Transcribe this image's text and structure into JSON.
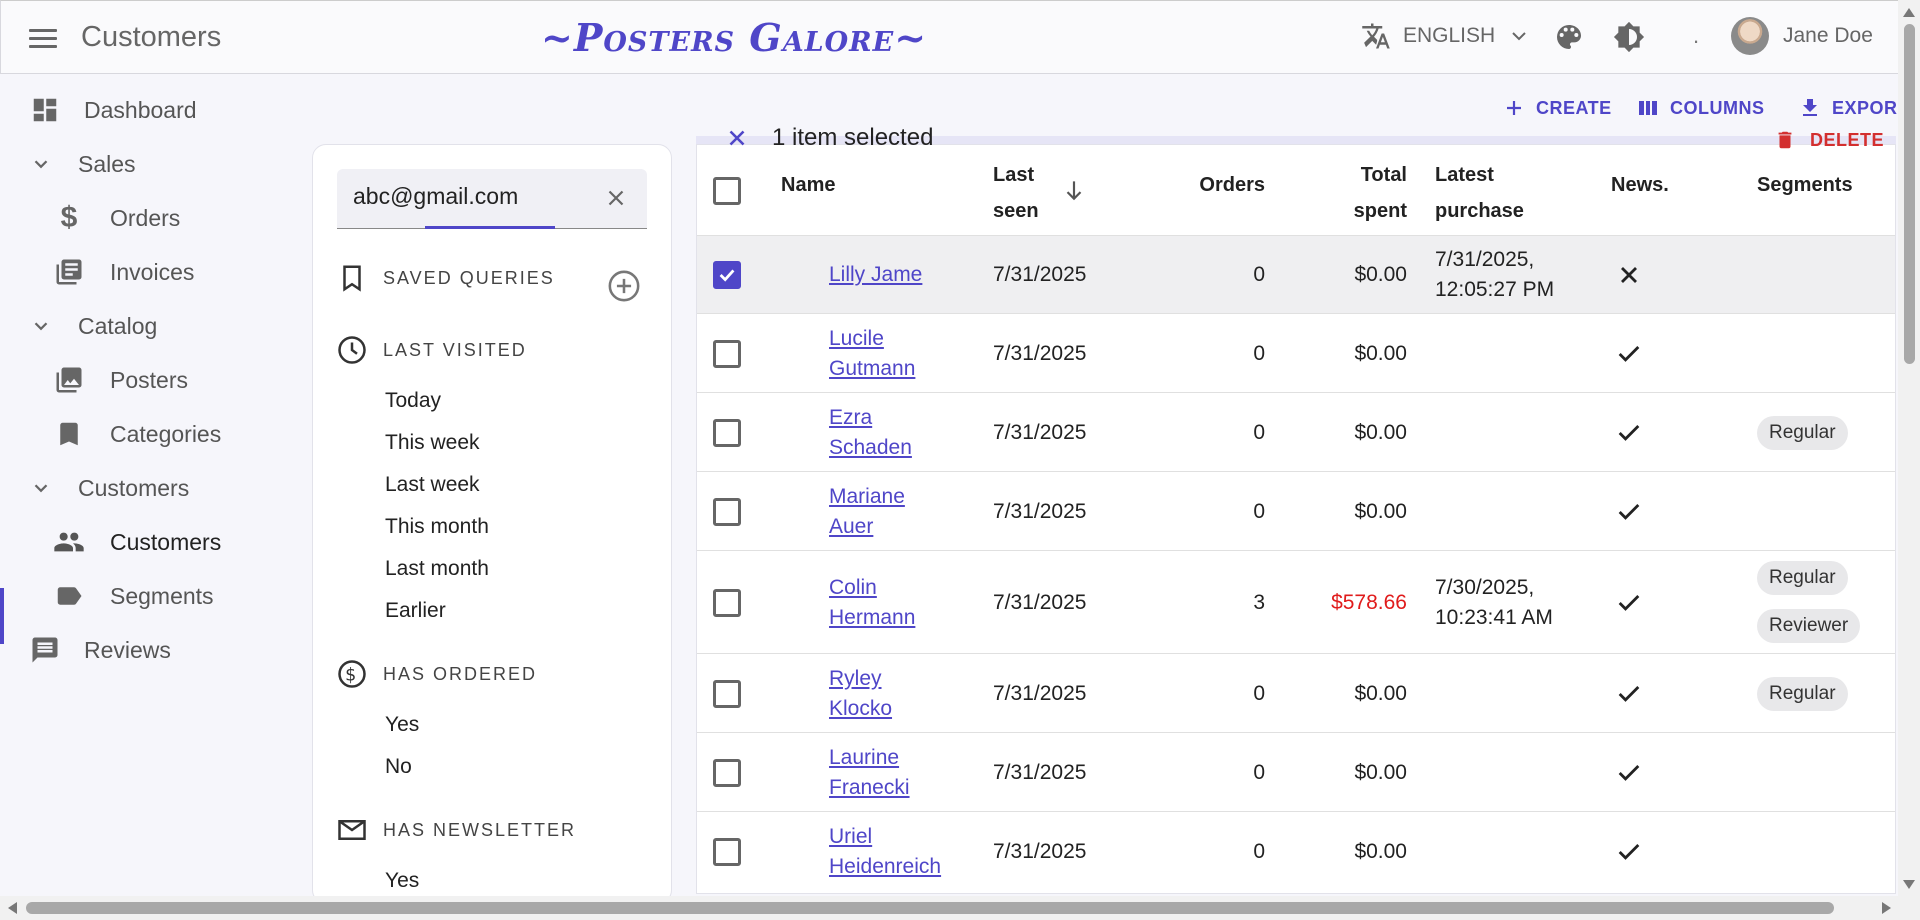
{
  "app": {
    "title": "Customers",
    "brand": "~Posters Galore~"
  },
  "header": {
    "language": "ENGLISH",
    "dot": ".",
    "user_name": "Jane Doe"
  },
  "sidebar": {
    "dashboard": "Dashboard",
    "sales": "Sales",
    "orders": "Orders",
    "invoices": "Invoices",
    "catalog": "Catalog",
    "posters": "Posters",
    "categories": "Categories",
    "customers_group": "Customers",
    "customers": "Customers",
    "segments": "Segments",
    "reviews": "Reviews"
  },
  "filters": {
    "search_value": "abc@gmail.com",
    "saved_queries": "SAVED QUERIES",
    "last_visited": "LAST VISITED",
    "last_visited_options": [
      "Today",
      "This week",
      "Last week",
      "This month",
      "Last month",
      "Earlier"
    ],
    "has_ordered": "HAS ORDERED",
    "has_ordered_options": [
      "Yes",
      "No"
    ],
    "has_newsletter": "HAS NEWSLETTER",
    "has_newsletter_options": [
      "Yes"
    ]
  },
  "toolbar": {
    "create": "CREATE",
    "columns": "COLUMNS",
    "export": "EXPOR",
    "delete": "DELETE",
    "selection": "1 item selected"
  },
  "table": {
    "headers": {
      "name": "Name",
      "last_seen_1": "Last",
      "last_seen_2": "seen",
      "orders": "Orders",
      "total_1": "Total",
      "total_2": "spent",
      "latest_1": "Latest",
      "latest_2": "purchase",
      "news": "News.",
      "segments": "Segments"
    },
    "rows": [
      {
        "name1": "Lilly Jame",
        "name2": "",
        "last_seen": "7/31/2025",
        "orders": "0",
        "total": "$0.00",
        "latest1": "7/31/2025,",
        "latest2": "12:05:27 PM",
        "news": "no",
        "segments": [],
        "selected": true
      },
      {
        "name1": "Lucile",
        "name2": "Gutmann",
        "last_seen": "7/31/2025",
        "orders": "0",
        "total": "$0.00",
        "latest1": "",
        "latest2": "",
        "news": "yes",
        "segments": [],
        "selected": false
      },
      {
        "name1": "Ezra",
        "name2": "Schaden",
        "last_seen": "7/31/2025",
        "orders": "0",
        "total": "$0.00",
        "latest1": "",
        "latest2": "",
        "news": "yes",
        "segments": [
          "Regular"
        ],
        "selected": false
      },
      {
        "name1": "Mariane",
        "name2": "Auer",
        "last_seen": "7/31/2025",
        "orders": "0",
        "total": "$0.00",
        "latest1": "",
        "latest2": "",
        "news": "yes",
        "segments": [],
        "selected": false
      },
      {
        "name1": "Colin",
        "name2": "Hermann",
        "last_seen": "7/31/2025",
        "orders": "3",
        "total": "$578.66",
        "latest1": "7/30/2025,",
        "latest2": "10:23:41 AM",
        "news": "yes",
        "segments": [
          "Regular",
          "Reviewer"
        ],
        "selected": false
      },
      {
        "name1": "Ryley",
        "name2": "Klocko",
        "last_seen": "7/31/2025",
        "orders": "0",
        "total": "$0.00",
        "latest1": "",
        "latest2": "",
        "news": "yes",
        "segments": [
          "Regular"
        ],
        "selected": false
      },
      {
        "name1": "Laurine",
        "name2": "Franecki",
        "last_seen": "7/31/2025",
        "orders": "0",
        "total": "$0.00",
        "latest1": "",
        "latest2": "",
        "news": "yes",
        "segments": [],
        "selected": false
      },
      {
        "name1": "Uriel",
        "name2": "Heidenreich",
        "last_seen": "7/31/2025",
        "orders": "0",
        "total": "$0.00",
        "latest1": "",
        "latest2": "",
        "news": "yes",
        "segments": [],
        "selected": false
      }
    ]
  },
  "colors": {
    "accent": "#4f46c8",
    "danger": "#d32f2f",
    "negative_amount": "#e01b1b"
  }
}
